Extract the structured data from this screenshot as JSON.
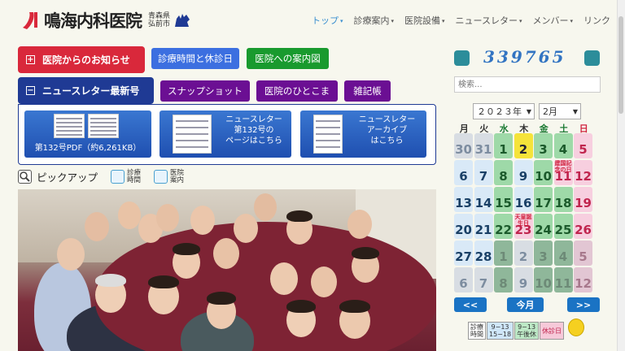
{
  "header": {
    "site_name": "鳴海内科医院",
    "pref_label": "青森県",
    "city_label": "弘前市",
    "nav": [
      {
        "label": "トップ",
        "caret": "▾"
      },
      {
        "label": "診療案内",
        "caret": "▾"
      },
      {
        "label": "医院設備",
        "caret": "▾"
      },
      {
        "label": "ニュースレター",
        "caret": "▾"
      },
      {
        "label": "メンバー",
        "caret": "▾"
      },
      {
        "label": "リンク",
        "caret": ""
      }
    ]
  },
  "buttons": {
    "news": "医院からのお知らせ",
    "news_sign": "+",
    "hours": "診療時間と休診日",
    "map": "医院への案内図",
    "newsletter": "ニュースレター最新号",
    "newsletter_sign": "−",
    "snapshot": "スナップショット",
    "hitokoma": "医院のひとこま",
    "zakki": "雑記帳"
  },
  "newsletter_cards": [
    {
      "line1": "第132号PDF（約6,261KB）",
      "line2": "",
      "line3": ""
    },
    {
      "line1": "ニュースレター",
      "line2": "第132号の",
      "line3": "ページはこちら"
    },
    {
      "line1": "ニュースレター",
      "line2": "アーカイブ",
      "line3": "はこちら"
    }
  ],
  "pickup": {
    "label": "ピックアップ",
    "links": [
      {
        "line1": "診療",
        "line2": "時間"
      },
      {
        "line1": "医院",
        "line2": "案内"
      }
    ]
  },
  "counter": {
    "value": "339765"
  },
  "search": {
    "placeholder": "検索..."
  },
  "calendar": {
    "year": "２０２３年",
    "month": "2月",
    "weekdays": [
      "月",
      "火",
      "水",
      "木",
      "金",
      "土",
      "日"
    ],
    "weekday_colors": [
      "#333333",
      "#333333",
      "#1b7a33",
      "#333333",
      "#1b7a33",
      "#1b7a33",
      "#d0233f"
    ],
    "weeks": [
      [
        {
          "d": "30",
          "c": "o"
        },
        {
          "d": "31",
          "c": "o"
        },
        {
          "d": "1",
          "c": "g"
        },
        {
          "d": "2",
          "c": "t"
        },
        {
          "d": "3",
          "c": "g"
        },
        {
          "d": "4",
          "c": "g"
        },
        {
          "d": "5",
          "c": "p"
        }
      ],
      [
        {
          "d": "6",
          "c": ""
        },
        {
          "d": "7",
          "c": ""
        },
        {
          "d": "8",
          "c": "g"
        },
        {
          "d": "9",
          "c": ""
        },
        {
          "d": "10",
          "c": "g"
        },
        {
          "d": "11",
          "c": "p",
          "note": "建国記念の日"
        },
        {
          "d": "12",
          "c": "p"
        }
      ],
      [
        {
          "d": "13",
          "c": ""
        },
        {
          "d": "14",
          "c": ""
        },
        {
          "d": "15",
          "c": "g"
        },
        {
          "d": "16",
          "c": ""
        },
        {
          "d": "17",
          "c": "g"
        },
        {
          "d": "18",
          "c": "g"
        },
        {
          "d": "19",
          "c": "p"
        }
      ],
      [
        {
          "d": "20",
          "c": ""
        },
        {
          "d": "21",
          "c": ""
        },
        {
          "d": "22",
          "c": "g"
        },
        {
          "d": "23",
          "c": "p",
          "note": "天皇誕生日"
        },
        {
          "d": "24",
          "c": "g"
        },
        {
          "d": "25",
          "c": "g"
        },
        {
          "d": "26",
          "c": "p"
        }
      ],
      [
        {
          "d": "27",
          "c": ""
        },
        {
          "d": "28",
          "c": ""
        },
        {
          "d": "1",
          "c": "g o"
        },
        {
          "d": "2",
          "c": "o"
        },
        {
          "d": "3",
          "c": "g o"
        },
        {
          "d": "4",
          "c": "g o"
        },
        {
          "d": "5",
          "c": "p o"
        }
      ],
      [
        {
          "d": "6",
          "c": "o"
        },
        {
          "d": "7",
          "c": "o"
        },
        {
          "d": "8",
          "c": "g o"
        },
        {
          "d": "9",
          "c": "o"
        },
        {
          "d": "10",
          "c": "g o"
        },
        {
          "d": "11",
          "c": "g o"
        },
        {
          "d": "12",
          "c": "p o"
        }
      ]
    ],
    "prev": "<<",
    "today": "今月",
    "next": ">>"
  },
  "legend": {
    "item1_line1": "診療",
    "item1_line2": "時間",
    "item2_line1": "9−13",
    "item2_line2": "15−18",
    "item3_line1": "9−13",
    "item3_line2": "午後休",
    "item4": "休診日"
  }
}
